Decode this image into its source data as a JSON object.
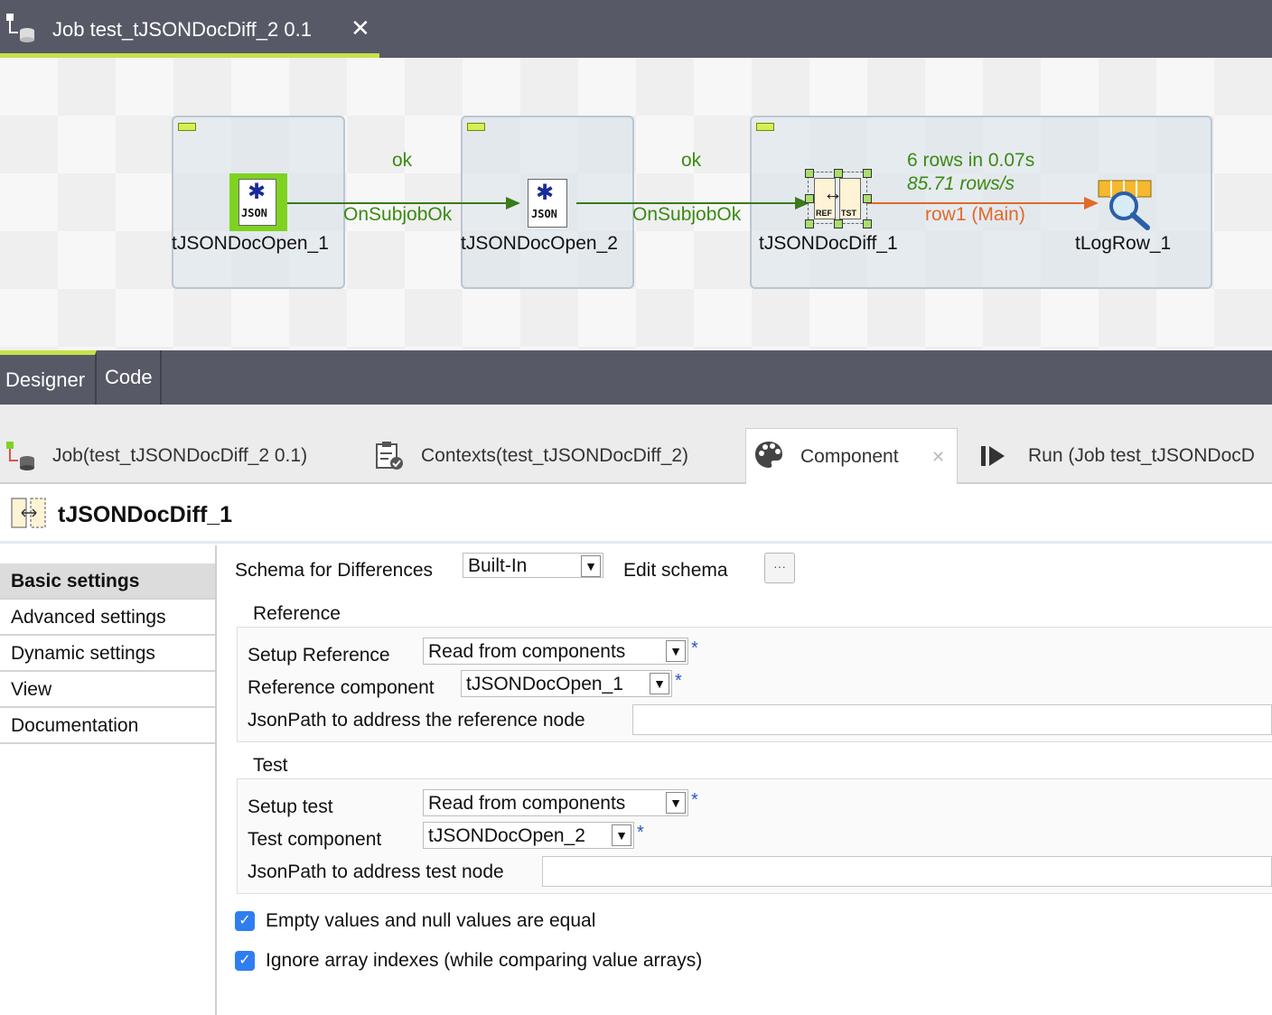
{
  "editor": {
    "tab_title": "Job test_tJSONDocDiff_2 0.1",
    "close_glyph": "✕",
    "accent_color": "#c8e04a"
  },
  "canvas": {
    "components": [
      {
        "label": "tJSONDocOpen_1",
        "icon": "json-doc-icon"
      },
      {
        "label": "tJSONDocOpen_2",
        "icon": "json-doc-icon"
      },
      {
        "label": "tJSONDocDiff_1",
        "icon": "json-diff-icon"
      },
      {
        "label": "tLogRow_1",
        "icon": "log-row-icon"
      }
    ],
    "links": [
      {
        "status": "ok",
        "name": "OnSubjobOk"
      },
      {
        "status": "ok",
        "name": "OnSubjobOk"
      }
    ],
    "row_link": {
      "stats": "6 rows in 0.07s",
      "rate": "85.71 rows/s",
      "name": "row1 (Main)"
    },
    "json_icon_text": "JSON",
    "diff_ref_text": "REF",
    "diff_tst_text": "TST"
  },
  "designer_bar": {
    "designer": "Designer",
    "code": "Code"
  },
  "view_tabs": {
    "job": "Job(test_tJSONDocDiff_2 0.1)",
    "contexts": "Contexts(test_tJSONDocDiff_2)",
    "component": "Component",
    "component_close": "✕",
    "run": "Run (Job test_tJSONDocD"
  },
  "component_panel": {
    "title": "tJSONDocDiff_1",
    "sidebar": [
      "Basic settings",
      "Advanced settings",
      "Dynamic settings",
      "View",
      "Documentation"
    ],
    "schema_label": "Schema for Differences",
    "schema_value": "Built-In",
    "edit_schema_label": "Edit schema",
    "edit_schema_button": "···",
    "reference": {
      "section": "Reference",
      "setup_label": "Setup Reference",
      "setup_value": "Read from components",
      "component_label": "Reference component",
      "component_value": "tJSONDocOpen_1",
      "jsonpath_label": "JsonPath to address the reference node",
      "jsonpath_value": ""
    },
    "test": {
      "section": "Test",
      "setup_label": "Setup test",
      "setup_value": "Read from components",
      "component_label": "Test component",
      "component_value": "tJSONDocOpen_2",
      "jsonpath_label": "JsonPath to address test node",
      "jsonpath_value": ""
    },
    "required_mark": "*",
    "checkboxes": [
      {
        "label": "Empty values and null values are equal",
        "checked": true
      },
      {
        "label": "Ignore array indexes (while comparing value arrays)",
        "checked": true
      }
    ],
    "check_glyph": "✓",
    "arrow_glyph": "▼"
  }
}
